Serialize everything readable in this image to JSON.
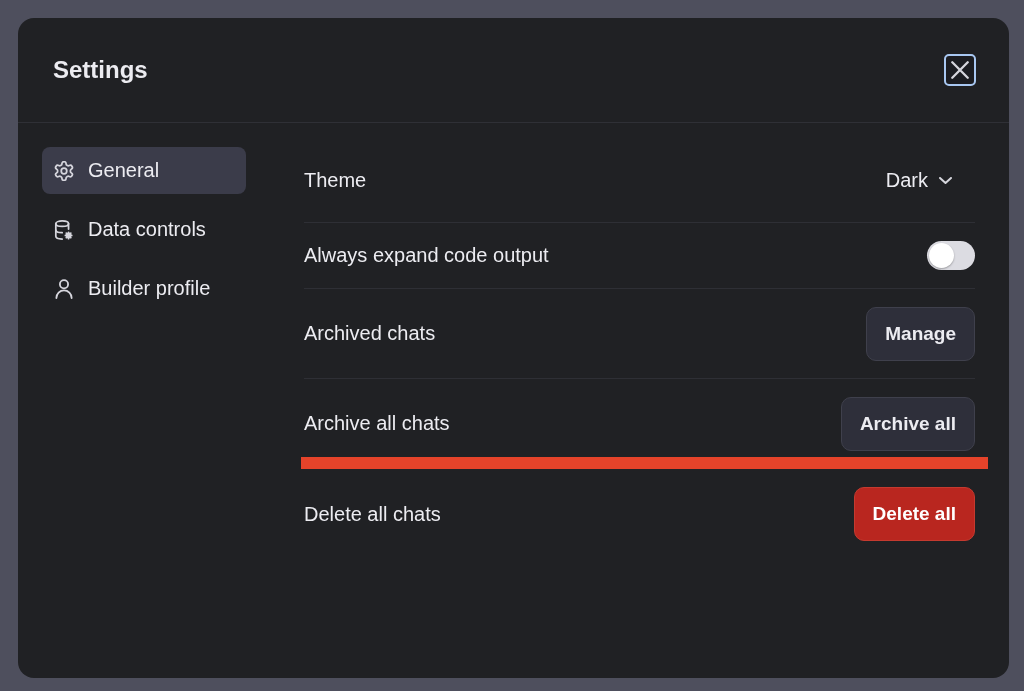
{
  "dialog": {
    "title": "Settings"
  },
  "sidebar": {
    "items": [
      {
        "label": "General",
        "selected": true
      },
      {
        "label": "Data controls",
        "selected": false
      },
      {
        "label": "Builder profile",
        "selected": false
      }
    ]
  },
  "rows": [
    {
      "kind": "select",
      "label": "Theme",
      "value": "Dark",
      "highlighted": false
    },
    {
      "kind": "toggle",
      "label": "Always expand code output",
      "on": false,
      "highlighted": false
    },
    {
      "kind": "button",
      "label": "Archived chats",
      "button": "Manage",
      "highlighted": false
    },
    {
      "kind": "button",
      "label": "Archive all chats",
      "button": "Archive all",
      "highlighted": true
    },
    {
      "kind": "danger_button",
      "label": "Delete all chats",
      "button": "Delete all",
      "highlighted": false
    }
  ]
}
